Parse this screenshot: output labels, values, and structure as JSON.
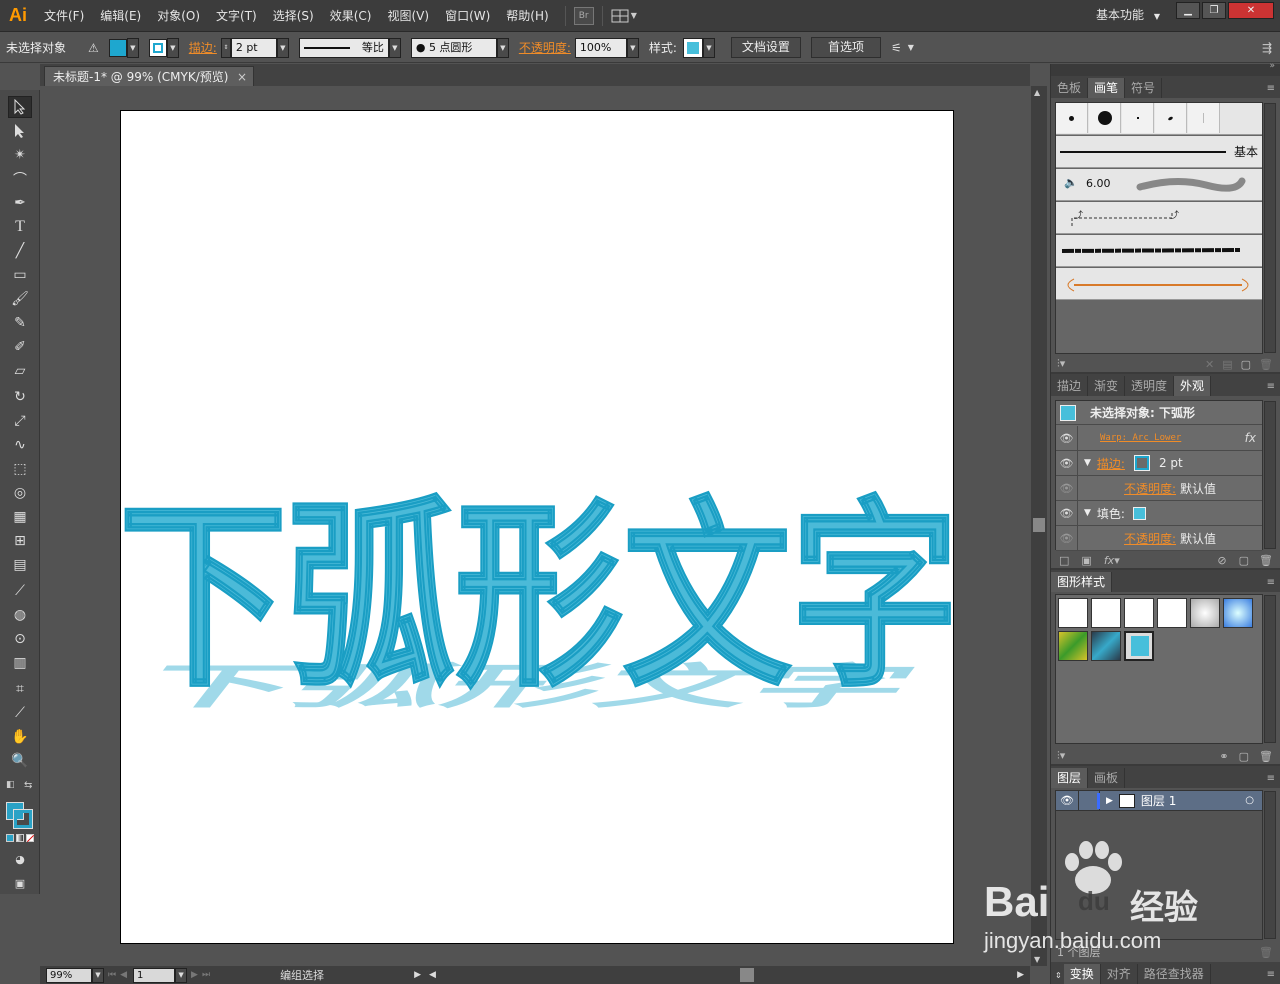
{
  "app": {
    "logo": "Ai"
  },
  "menu": [
    "文件(F)",
    "编辑(E)",
    "对象(O)",
    "文字(T)",
    "选择(S)",
    "效果(C)",
    "视图(V)",
    "窗口(W)",
    "帮助(H)"
  ],
  "menubar": {
    "bridge_label": "Br",
    "workspace": "基本功能"
  },
  "control": {
    "selection": "未选择对象",
    "stroke_label": "描边:",
    "stroke_value": "2 pt",
    "profile_label": "等比",
    "brush_value": "5 点圆形",
    "opacity_label": "不透明度:",
    "opacity_value": "100%",
    "style_label": "样式:",
    "doc_setup": "文档设置",
    "preferences": "首选项",
    "fill_color": "#1ea7cf",
    "stroke_color": "#1ea7cf"
  },
  "document": {
    "tab_title": "未标题-1* @ 99% (CMYK/预览)",
    "close": "×",
    "artwork_text": "下弧形文字",
    "text_color": "#4bbad8",
    "outline_color": "#1a9ec4",
    "shadow_color": "#9bd8e8"
  },
  "status": {
    "zoom": "99%",
    "page": "1",
    "mode": "编组选择"
  },
  "panels": {
    "top_tabs": [
      "色板",
      "画笔",
      "符号"
    ],
    "brush_basic": "基本",
    "brush_size": "6.00",
    "appearance_tabs": [
      "描边",
      "渐变",
      "透明度",
      "外观"
    ],
    "appearance": {
      "header": "未选择对象: 下弧形",
      "warp": "Warp: Arc Lower",
      "stroke_label": "描边:",
      "stroke_value": "2 pt",
      "opacity_label": "不透明度:",
      "opacity_value": "默认值",
      "fill_label": "填色:",
      "opacity2_label": "不透明度:",
      "opacity2_value": "默认值"
    },
    "graphic_styles_tab": "图形样式",
    "layers_tabs": [
      "图层",
      "画板"
    ],
    "layer_name": "图层 1",
    "layers_count": "1 个图层",
    "bottom_tabs": [
      "变换",
      "对齐",
      "路径查找器"
    ]
  },
  "watermark": {
    "brand": "Bai",
    "brand2": "du",
    "cn": "经验",
    "url": "jingyan.baidu.com"
  }
}
